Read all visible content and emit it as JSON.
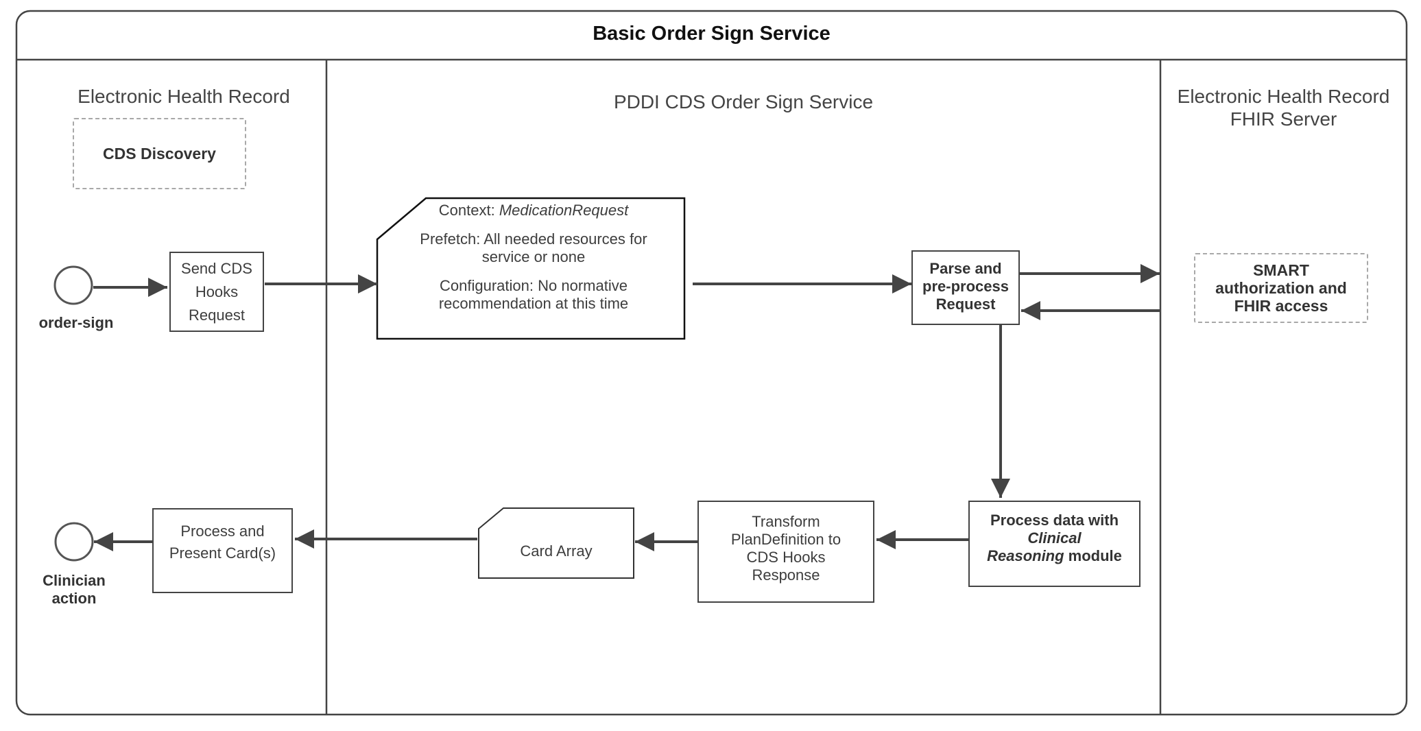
{
  "diagram": {
    "title": "Basic Order Sign Service",
    "lanes": [
      {
        "id": "ehr",
        "title": "Electronic Health Record"
      },
      {
        "id": "cds",
        "title": "PDDI CDS Order Sign Service"
      },
      {
        "id": "fhir",
        "title_line1": "Electronic Health Record",
        "title_line2": "FHIR Server"
      }
    ],
    "ehr": {
      "cds_discovery": "CDS Discovery",
      "start_event": "order-sign",
      "send_request": [
        "Send CDS",
        "Hooks",
        "Request"
      ],
      "present_cards": [
        "Process and",
        "Present Card(s)"
      ],
      "end_event": [
        "Clinician",
        "action"
      ]
    },
    "cds": {
      "request_doc": {
        "context_label": "Context: ",
        "context_value": "MedicationRequest",
        "prefetch": [
          "Prefetch: All needed resources for",
          "service or none"
        ],
        "configuration": [
          "Configuration: No normative",
          "recommendation at this time"
        ]
      },
      "parse": [
        "Parse and",
        "pre-process",
        "Request"
      ],
      "process_data": {
        "line1": "Process data with",
        "line2_italic": "Clinical",
        "line3_italic": "Reasoning",
        "line3_rest": " module"
      },
      "transform": [
        "Transform",
        "PlanDefinition to",
        "CDS Hooks",
        "Response"
      ],
      "card_array": "Card Array"
    },
    "fhir": {
      "smart": [
        "SMART",
        "authorization and",
        "FHIR access"
      ]
    },
    "colors": {
      "stroke": "#444444",
      "dashed": "#a8a8a8",
      "text": "#3a3a3a"
    }
  }
}
